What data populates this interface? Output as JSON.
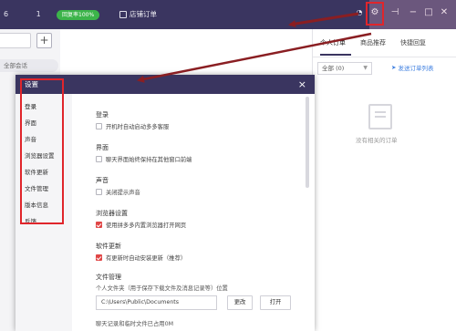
{
  "titlebar": {
    "user": "6",
    "user_suffix": "1",
    "badge": "回复率100%",
    "store_label": "店铺订单"
  },
  "left": {
    "plus": "+",
    "session_tab": "全部会话"
  },
  "right_panel": {
    "tabs": [
      "个人订单",
      "商品推荐",
      "快捷回复"
    ],
    "filter": "全部 (0)",
    "send_label": "发送订单列表",
    "empty_text": "没有相关的订单"
  },
  "dialog": {
    "title": "设置",
    "close": "×",
    "nav": [
      "登录",
      "界面",
      "声音",
      "浏览器设置",
      "软件更新",
      "文件管理",
      "版本信息",
      "反馈"
    ],
    "sections": {
      "login": {
        "title": "登录",
        "option": "开机时自动启动多多客服",
        "checked": false
      },
      "ui": {
        "title": "界面",
        "option": "聊天界面始终保持在其他窗口前端",
        "checked": false
      },
      "sound": {
        "title": "声音",
        "option": "关闭提示声音",
        "checked": false
      },
      "browser": {
        "title": "浏览器设置",
        "option": "使用拼多多内置浏览器打开网页",
        "checked": true
      },
      "update": {
        "title": "软件更新",
        "option": "有更新时自动安装更新（推荐）",
        "checked": true
      },
      "files": {
        "title": "文件管理",
        "desc": "个人文件夹（用于保存下载文件及消息记录等）位置",
        "path": "C:\\Users\\Public\\Documents",
        "change_btn": "更改",
        "open_btn": "打开",
        "cut_line": "聊天记录和临时文件已占用0M"
      }
    }
  },
  "colors": {
    "titlebar": "#3a3560",
    "highlight": "#e0252b",
    "badge": "#3cb44a",
    "link": "#3c7ee0"
  },
  "icons": [
    "gear-icon",
    "pin-icon",
    "minimize-icon",
    "maximize-icon",
    "close-icon",
    "settings-status-icon"
  ]
}
